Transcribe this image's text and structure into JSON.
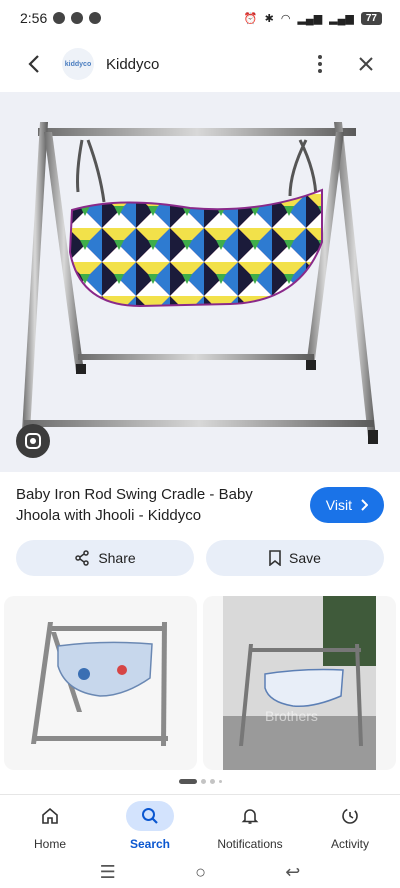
{
  "status_bar": {
    "time": "2:56",
    "battery": "77"
  },
  "header": {
    "site_name": "Kiddyco",
    "logo_text": "kiddyco"
  },
  "product": {
    "title": "Baby Iron Rod Swing Cradle - Baby Jhoola with Jhooli - Kiddyco"
  },
  "actions": {
    "visit_label": "Visit",
    "share_label": "Share",
    "save_label": "Save"
  },
  "thumbnails": [
    {
      "name": "related-image-1"
    },
    {
      "name": "related-image-2",
      "watermark": "Brothers"
    }
  ],
  "bottom_nav": [
    {
      "label": "Home",
      "icon": "home-icon",
      "active": false
    },
    {
      "label": "Search",
      "icon": "search-icon",
      "active": true
    },
    {
      "label": "Notifications",
      "icon": "bell-icon",
      "active": false
    },
    {
      "label": "Activity",
      "icon": "activity-icon",
      "active": false
    }
  ],
  "colors": {
    "accent": "#1a73e8",
    "chip_bg": "#e8eef8",
    "nav_active_bg": "#d3e3fd"
  }
}
